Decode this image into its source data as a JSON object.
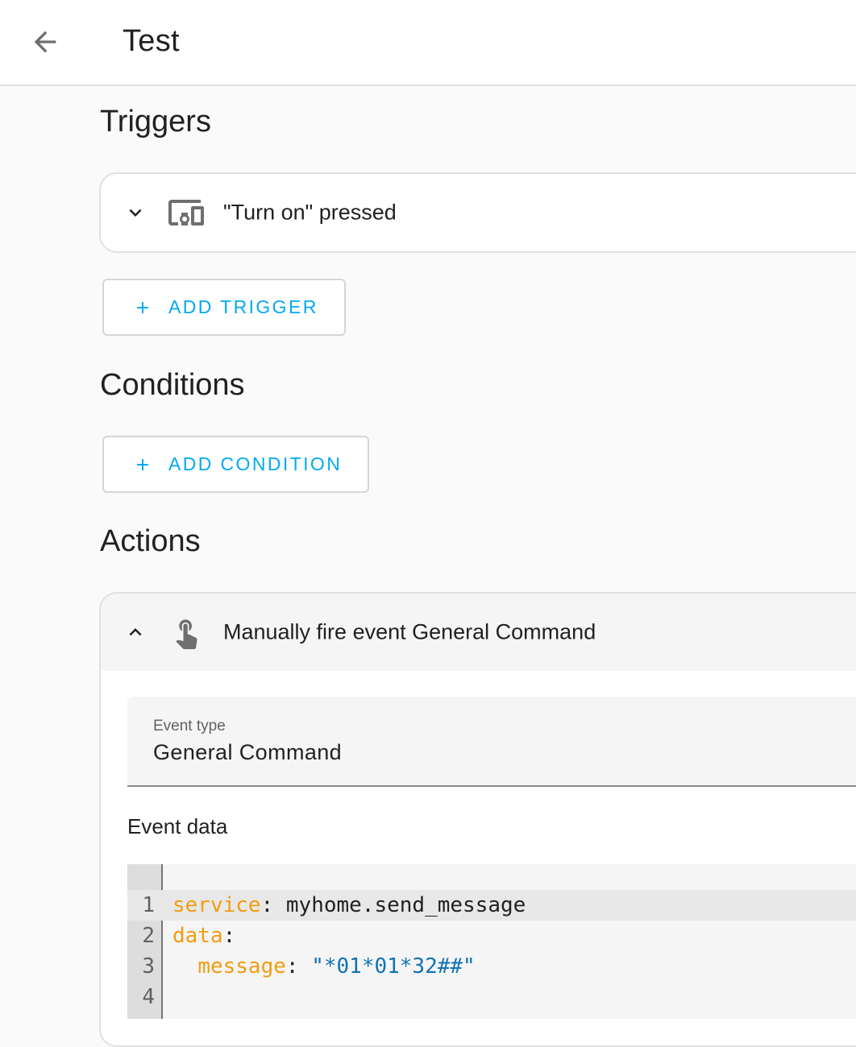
{
  "header": {
    "title": "Test",
    "back_icon": "arrow-left-icon"
  },
  "triggers": {
    "title": "Triggers",
    "items": [
      {
        "label": "\"Turn on\" pressed",
        "icon": "devices-icon",
        "expanded": false
      }
    ],
    "add_label": "ADD TRIGGER"
  },
  "conditions": {
    "title": "Conditions",
    "add_label": "ADD CONDITION"
  },
  "actions": {
    "title": "Actions",
    "items": [
      {
        "label": "Manually fire event General Command",
        "icon": "gesture-tap-icon",
        "expanded": true,
        "event_type_label": "Event type",
        "event_type_value": "General Command",
        "event_data_label": "Event data",
        "code_lines": [
          {
            "num": "1",
            "key": "service",
            "sep": ": ",
            "value": "myhome.send_message"
          },
          {
            "num": "2",
            "key": "data",
            "sep": ":",
            "value": ""
          },
          {
            "num": "3",
            "indent": "  ",
            "key": "message",
            "sep": ": ",
            "str": "\"*01*01*32##\""
          },
          {
            "num": "4"
          }
        ]
      }
    ]
  },
  "colors": {
    "accent": "#03a9f4",
    "yaml_key": "#f29c11",
    "yaml_string": "#0f72b5"
  }
}
